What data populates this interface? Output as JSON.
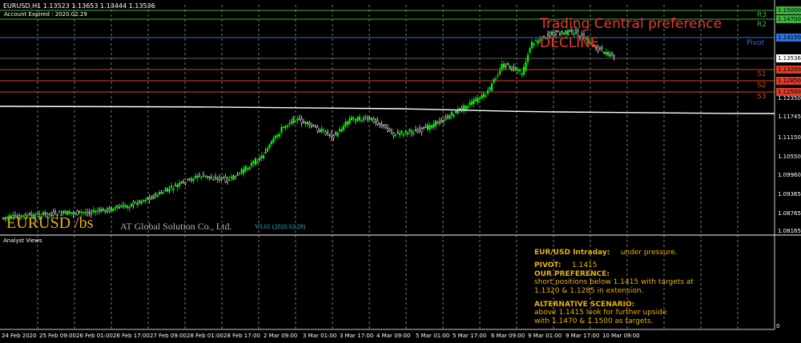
{
  "header": {
    "symbol_line": "EURUSD,H1  1.13523 1.13653 1.13444 1.13536",
    "account_expired": "Account Expired : 2020.02.29"
  },
  "overlay": {
    "symbol": "EURUSD /bs",
    "company": "AT Global Solution Co., Ltd.",
    "version": "V3.01 (2020.02.29)"
  },
  "preference": {
    "title": "Trading Central preference",
    "direction": "DECLINE"
  },
  "levels": [
    {
      "label": "R3",
      "price": "1.15000",
      "color": "#3cb23c"
    },
    {
      "label": "R2",
      "price": "1.14700",
      "color": "#3cb23c"
    },
    {
      "label": "Pivot",
      "price": "1.14150",
      "color": "#2f6fdb"
    },
    {
      "label": "S1",
      "price": "1.13200",
      "color": "#e03c28"
    },
    {
      "label": "S2",
      "price": "1.12850",
      "color": "#e03c28"
    },
    {
      "label": "S3",
      "price": "1.12500",
      "color": "#e03c28"
    }
  ],
  "current_price": "1.13536",
  "y_axis_labels": [
    "1.12350",
    "1.11745",
    "1.11150",
    "1.10550",
    "1.09960",
    "1.09365",
    "1.08765",
    "1.08165"
  ],
  "x_axis_labels": [
    "24 Feb 2020",
    "25 Feb 09:00",
    "26 Feb 01:00",
    "26 Feb 17:00",
    "27 Feb 09:00",
    "28 Feb 01:00",
    "28 Feb 17:00",
    "2 Mar 09:00",
    "3 Mar 01:00",
    "3 Mar 17:00",
    "4 Mar 09:00",
    "5 Mar 01:00",
    "5 Mar 17:00",
    "6 Mar 09:00",
    "9 Mar 01:00",
    "9 Mar 17:00",
    "10 Mar 09:00"
  ],
  "subwindow": {
    "title": "Analyst Views",
    "axis_zero": "0"
  },
  "analyst": {
    "heading_label": "EUR/USD Intraday:",
    "heading_value": "under pressure.",
    "pivot_label": "PIVOT:",
    "pivot_value": "1.1415",
    "pref_title": "OUR PREFERENCE:",
    "pref_line1": "short positions below 1.1415 with targets at",
    "pref_line2": "1.1320 & 1.1285 in extension.",
    "alt_title": "ALTERNATIVE SCENARIO:",
    "alt_line1": "above 1.1415 look for further upside",
    "alt_line2": "with 1.1470 & 1.1500 as targets."
  },
  "colors": {
    "bull": "#00ff00",
    "bear": "#ffffff",
    "ma": "#ffffff",
    "gold": "#e8b00c",
    "version": "#2fa6c8",
    "pref": "#e53a2a"
  }
}
